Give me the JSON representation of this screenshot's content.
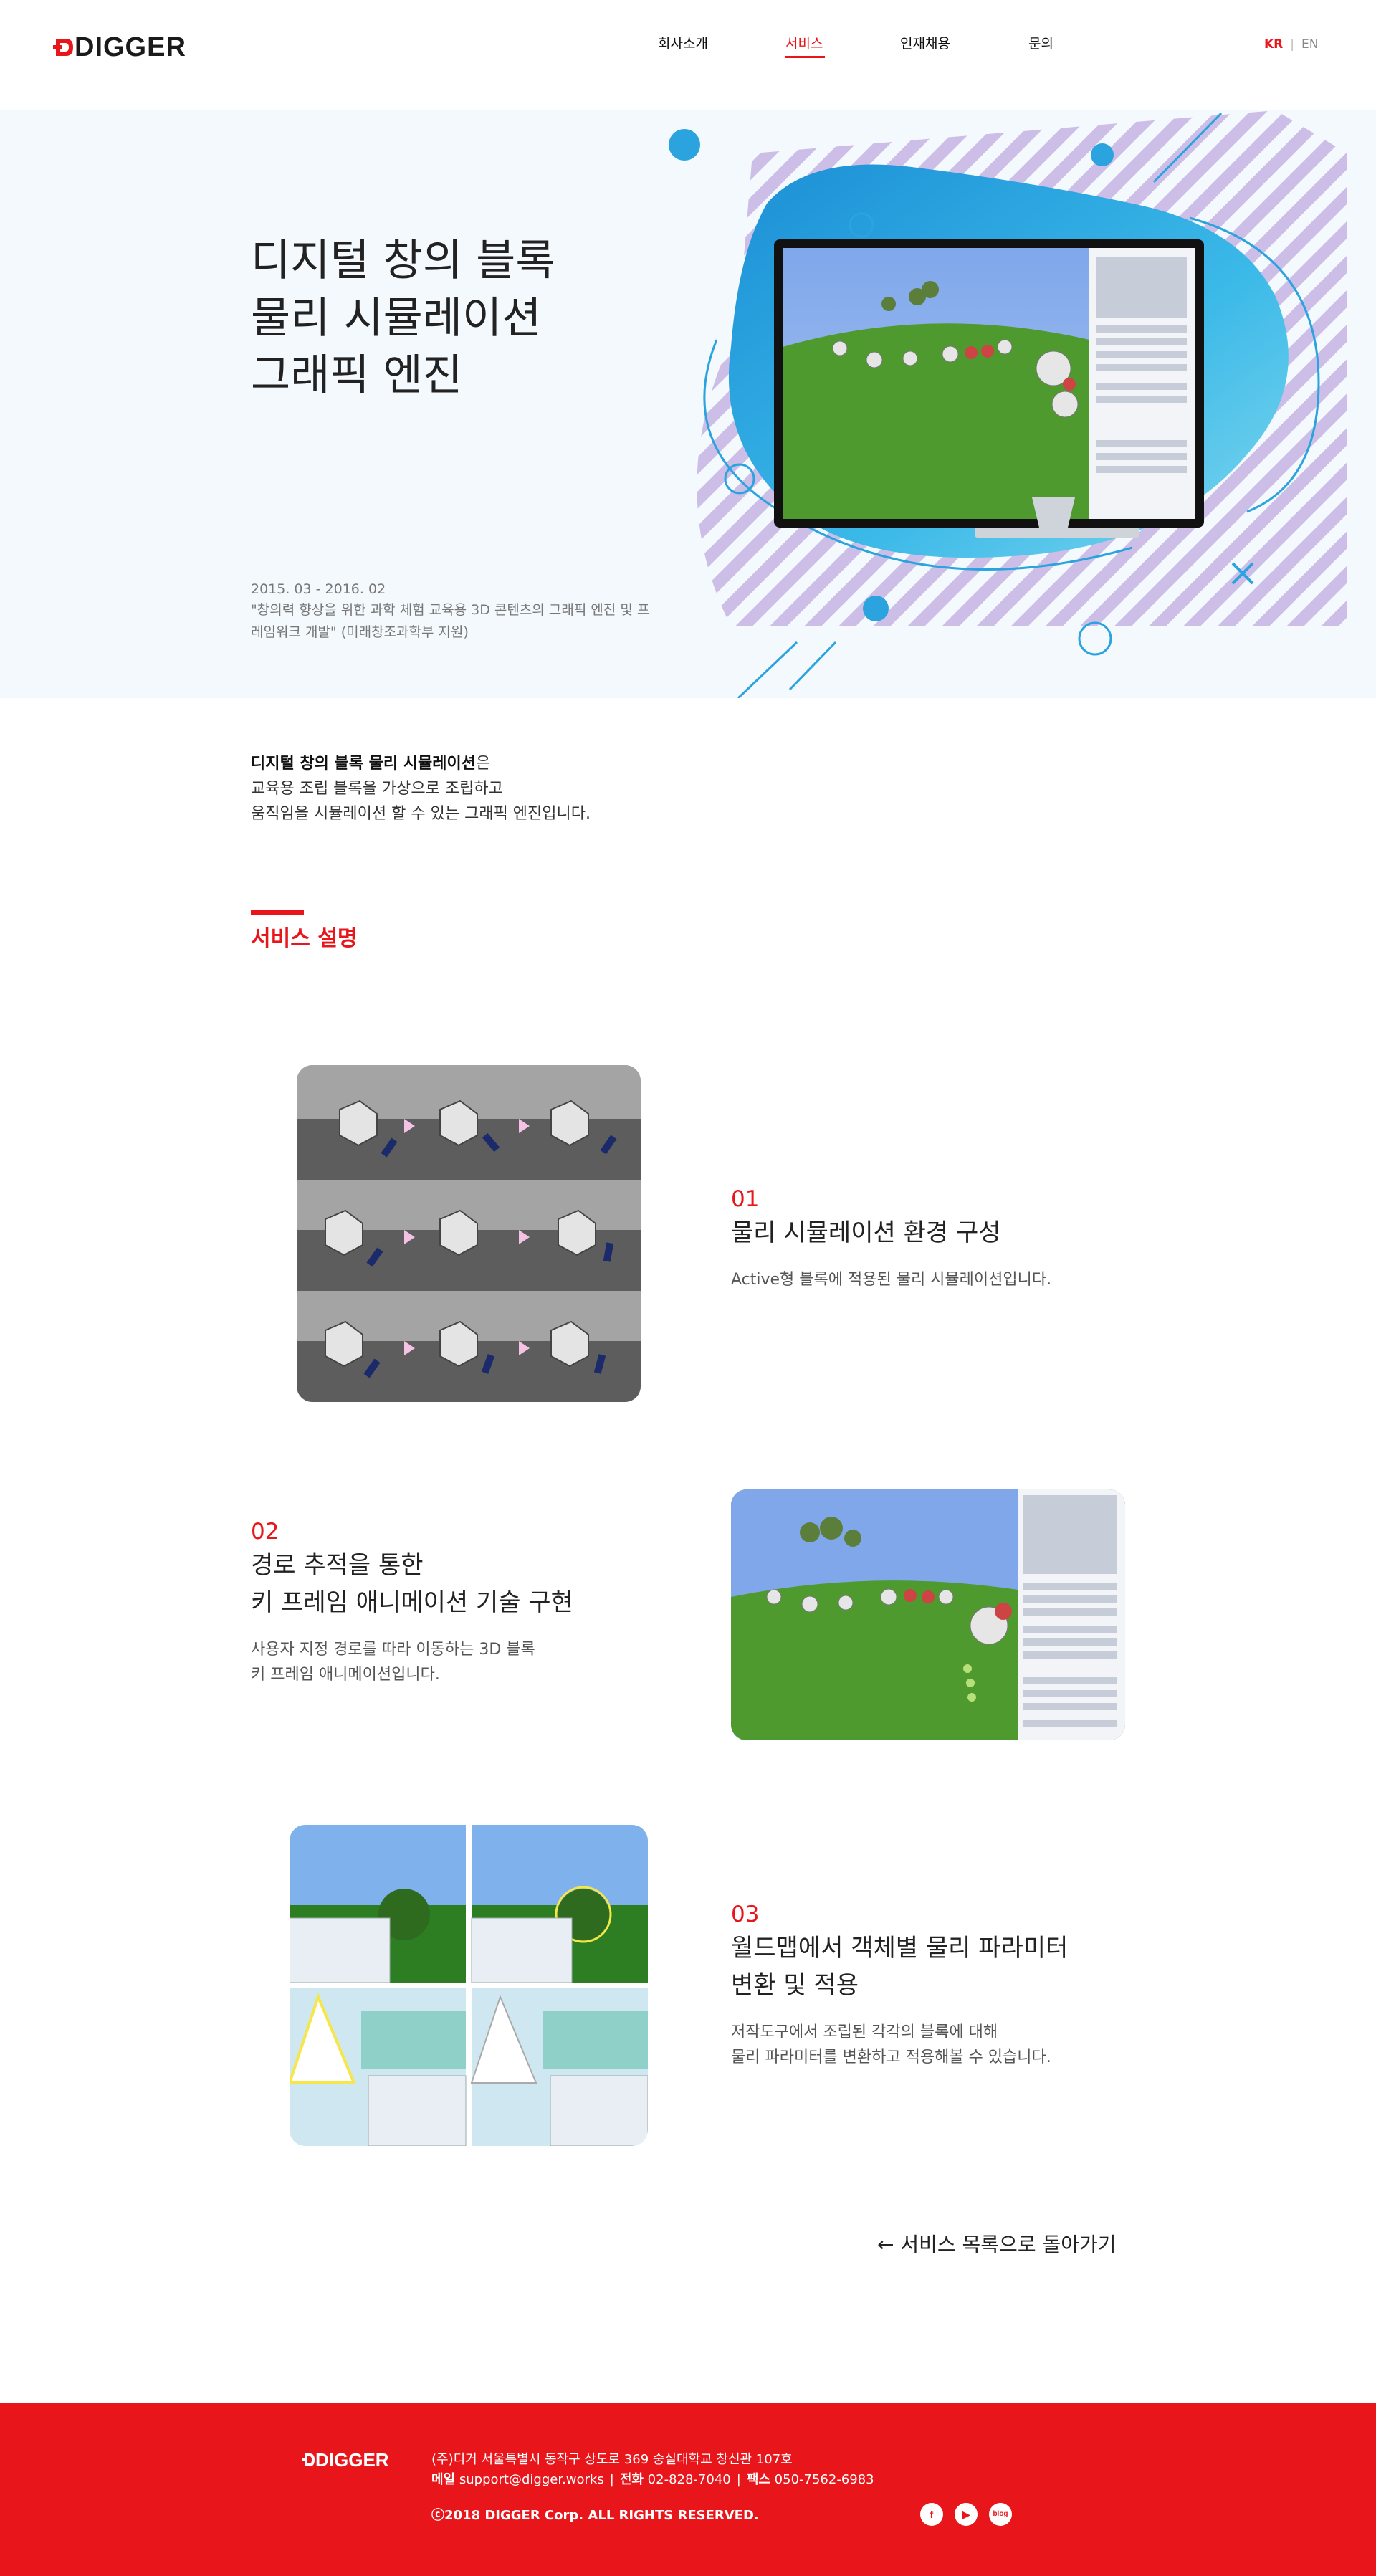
{
  "header": {
    "logo": "DIGGER",
    "nav": [
      {
        "label": "회사소개"
      },
      {
        "label": "서비스"
      },
      {
        "label": "인재채용"
      },
      {
        "label": "문의"
      }
    ],
    "lang": {
      "kr": "KR",
      "en": "EN"
    }
  },
  "hero": {
    "title_lines": [
      "디지털 창의 블록",
      "물리 시뮬레이션",
      "그래픽 엔진"
    ],
    "period": "2015. 03 - 2016. 02",
    "description": "\"창의력 향상을 위한 과학 체험 교육용 3D 콘텐츠의 그래픽 엔진 및 프레임워크 개발\" (미래창조과학부 지원)"
  },
  "intro": {
    "bold": "디지털 창의 블록 물리 시뮬레이션",
    "suffix": "은",
    "line2": "교육용 조립 블록을 가상으로 조립하고",
    "line3": "움직임을 시뮬레이션 할 수 있는 그래픽 엔진입니다."
  },
  "section": {
    "title": "서비스 설명"
  },
  "features": [
    {
      "num": "01",
      "title_lines": [
        "물리 시뮬레이션 환경 구성"
      ],
      "desc_lines": [
        "Active형 블록에 적용된 물리 시뮬레이션입니다."
      ]
    },
    {
      "num": "02",
      "title_lines": [
        "경로 추적을 통한",
        "키 프레임 애니메이션 기술 구현"
      ],
      "desc_lines": [
        "사용자 지정 경로를 따라 이동하는 3D 블록",
        "키 프레임 애니메이션입니다."
      ]
    },
    {
      "num": "03",
      "title_lines": [
        "월드맵에서 객체별 물리 파라미터",
        "변환 및 적용"
      ],
      "desc_lines": [
        "저작도구에서 조립된 각각의 블록에 대해",
        "물리 파라미터를 변환하고 적용해볼 수 있습니다."
      ]
    }
  ],
  "back_link": "← 서비스 목록으로 돌아가기",
  "footer": {
    "logo": "DIGGER",
    "company": "(주)디거",
    "address": "서울특별시 동작구 상도로 369 숭실대학교 창신관 107호",
    "email_label": "메일",
    "email": "support@digger.works",
    "phone_label": "전화",
    "phone": "02-828-7040",
    "fax_label": "팩스",
    "fax": "050-7562-6983",
    "copyright": "ⓒ2018 DIGGER Corp. ALL RIGHTS RESERVED.",
    "sns": [
      "facebook-icon",
      "youtube-icon",
      "blog-icon"
    ],
    "sns_blog_label": "blog"
  },
  "colors": {
    "accent": "#e8161b",
    "hero_bg": "#f3f9fc",
    "blob_blue": "#2aa3de"
  }
}
